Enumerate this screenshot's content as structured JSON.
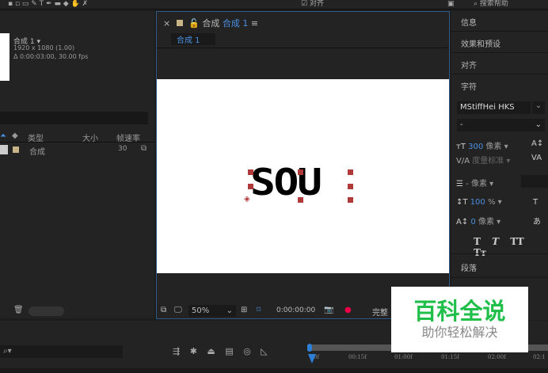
{
  "toolbar": {
    "align_label": "对齐",
    "search_help": "搜索帮助"
  },
  "project": {
    "comp_name": "合成 1",
    "resolution": "1920 x 1080 (1.00)",
    "duration": "Δ 0:00:03:00, 30.00 fps",
    "columns": [
      "类型",
      "大小",
      "帧速率"
    ],
    "rows": [
      {
        "type": "合成",
        "size": "",
        "fps": "30"
      }
    ]
  },
  "comp_panel": {
    "title_prefix": "合成",
    "title_name": "合成 1",
    "tab": "合成 1",
    "canvas_text": "SOU",
    "zoom": "50%",
    "timecode": "0:00:00:00",
    "quality": "完整"
  },
  "right_panel": {
    "info": "信息",
    "effects": "效果和预设",
    "align": "对齐",
    "character": "字符",
    "paragraph": "段落",
    "font": "MStiffHei HKS",
    "style": "-",
    "font_size": "300",
    "unit_px": "像素",
    "kerning": "度量标准",
    "leading": "- 像素",
    "vscale": "100",
    "percent": "%",
    "baseline": "0",
    "styles": [
      "T",
      "T",
      "TT",
      "Tт"
    ]
  },
  "timeline": {
    "ticks": [
      "0f",
      "00:15f",
      "01:00f",
      "01:15f",
      "02:00f",
      "02:1"
    ]
  },
  "watermark": {
    "title": "百科全说",
    "subtitle": "助你轻松解决"
  }
}
